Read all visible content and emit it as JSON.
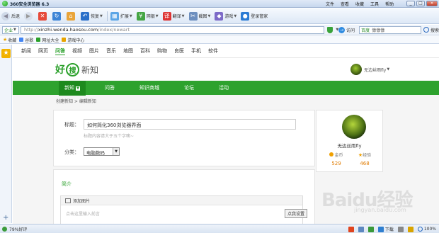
{
  "window": {
    "title": "360安全浏览器 6.3",
    "menus": [
      "文件",
      "查看",
      "收藏",
      "工具",
      "帮助"
    ]
  },
  "toolbar": {
    "back": "后退",
    "restore": "恢复",
    "extend": "扩展",
    "netbank": "网银",
    "translate": "翻译",
    "screenshot": "截图",
    "game": "游戏",
    "login": "登录管家"
  },
  "address": {
    "mode": "企业",
    "url_prefix": "http://",
    "url_host": "xinzhi.wenda.haosou.com",
    "url_path": "/index/newart",
    "visit": "访问",
    "search_engine": "百度",
    "search_text": "慷慷慷",
    "search_btn": "搜索"
  },
  "favbar": {
    "items": [
      "收藏",
      "谷歌",
      "网址大全",
      "游戏中心"
    ]
  },
  "page": {
    "topnav": [
      "新闻",
      "网页",
      "问答",
      "视频",
      "图片",
      "音乐",
      "地图",
      "百科",
      "购物",
      "良医",
      "手机",
      "软件"
    ],
    "topnav_active": "问答",
    "logo": {
      "hao": "好",
      "sou": "搜",
      "xinzhi": "新知"
    },
    "user_top": "无边丝雨fly",
    "greennav": [
      "新知",
      "问答",
      "知识商城",
      "论坛",
      "活动"
    ],
    "breadcrumb": "创建新知 > 编辑新知",
    "form": {
      "title_label": "标题：",
      "title_value": "如何简化360浏览器界面",
      "title_hint": "标题内容请大于五个字噢~",
      "category_label": "分类：",
      "category_value": "电脑数码"
    },
    "intro": {
      "title": "简介",
      "add_image": "添加图片",
      "placeholder": "点击这里输入前言",
      "tip_button": "点我设置"
    },
    "profile": {
      "name": "无边丝雨fly",
      "coins_label": "金币",
      "coins_value": "529",
      "xp_label": "经验",
      "xp_value": "468"
    }
  },
  "status": {
    "left": "79%好评",
    "download": "下载",
    "zoom": "100%"
  },
  "watermark": {
    "main": "Baidu经验",
    "sub": "jingyan.baidu.com"
  }
}
